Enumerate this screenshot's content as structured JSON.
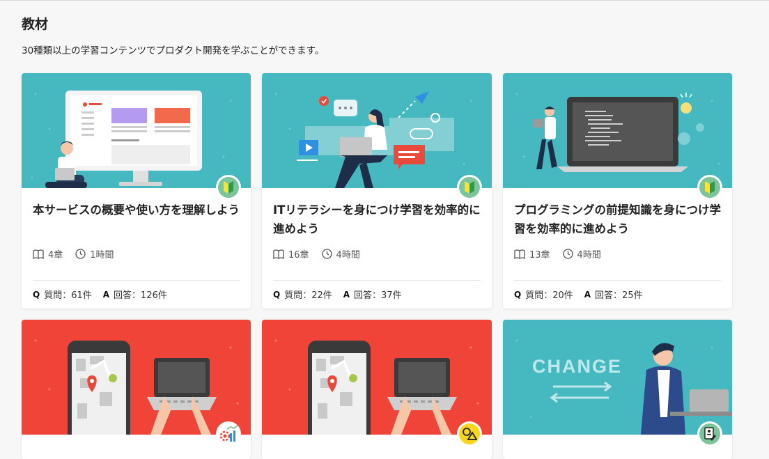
{
  "page": {
    "title": "教材",
    "description": "30種類以上の学習コンテンツでプロダクト開発を学ぶことができます。"
  },
  "colors": {
    "teal": "#46b8c0",
    "red": "#f04438",
    "badge_green": "#7cc499",
    "badge_yellow": "#f7d61c"
  },
  "cards": [
    {
      "title": "本サービスの概要や使い方を理解しよう",
      "chapters": "4章",
      "duration": "1時間",
      "questions": "質問：61件",
      "answers": "回答：126件",
      "badge_icon": "beginner-mark-icon"
    },
    {
      "title": "ITリテラシーを身につけ学習を効率的に進めよう",
      "chapters": "16章",
      "duration": "4時間",
      "questions": "質問：22件",
      "answers": "回答：37件",
      "badge_icon": "beginner-mark-icon"
    },
    {
      "title": "プログラミングの前提知識を身につけ学習を効率的に進めよう",
      "chapters": "13章",
      "duration": "4時間",
      "questions": "質問：20件",
      "answers": "回答：25件",
      "badge_icon": "beginner-mark-icon"
    },
    {
      "badge_icon": "settings-chart-icon"
    },
    {
      "badge_icon": "shapes-icon"
    },
    {
      "badge_icon": "profile-edit-icon",
      "thumb_text": "CHANGE"
    }
  ],
  "labels": {
    "q": "Q",
    "a": "A"
  }
}
